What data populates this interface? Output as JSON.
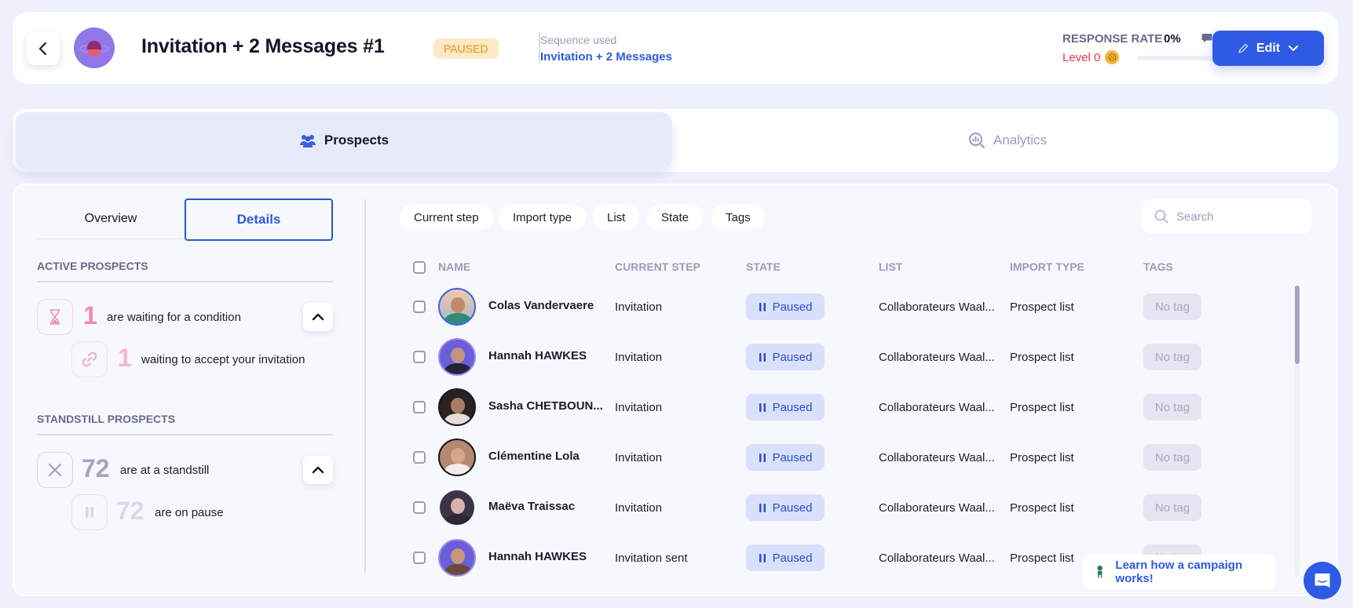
{
  "header": {
    "title": "Invitation + 2 Messages #1",
    "status": "PAUSED",
    "sequence_label": "Sequence used",
    "sequence_name": "Invitation + 2 Messages",
    "response_rate_label": "RESPONSE RATE",
    "response_rate_value": "0%",
    "level_label": "Level 0",
    "level_progress": 0,
    "edit_label": "Edit"
  },
  "tabs": [
    {
      "label": "Prospects",
      "icon": "users-icon",
      "active": true
    },
    {
      "label": "Analytics",
      "icon": "analytics-search-icon",
      "active": false
    }
  ],
  "segment": {
    "overview": "Overview",
    "details": "Details",
    "active": "Details"
  },
  "active_section": {
    "title": "ACTIVE PROSPECTS",
    "main": {
      "count": "1",
      "text": "are waiting for a condition",
      "icon": "hourglass-icon"
    },
    "sub": {
      "count": "1",
      "text": "waiting to accept your invitation",
      "icon": "link-icon"
    }
  },
  "standstill_section": {
    "title": "STANDSTILL PROSPECTS",
    "main": {
      "count": "72",
      "text": "are at a standstill",
      "icon": "x-icon"
    },
    "sub": {
      "count": "72",
      "text": "are on pause",
      "icon": "pause-icon"
    }
  },
  "filters": [
    "Current step",
    "Import type",
    "List",
    "State",
    "Tags"
  ],
  "search": {
    "placeholder": "Search",
    "value": ""
  },
  "table": {
    "columns": [
      "NAME",
      "CURRENT STEP",
      "STATE",
      "LIST",
      "IMPORT TYPE",
      "TAGS"
    ],
    "rows": [
      {
        "name": "Colas Vandervaere",
        "step": "Invitation",
        "state": "Paused",
        "list": "Collaborateurs Waal...",
        "import_type": "Prospect list",
        "tags": "No tag"
      },
      {
        "name": "Hannah HAWKES",
        "step": "Invitation",
        "state": "Paused",
        "list": "Collaborateurs Waal...",
        "import_type": "Prospect list",
        "tags": "No tag"
      },
      {
        "name": "Sasha CHETBOUN...",
        "step": "Invitation",
        "state": "Paused",
        "list": "Collaborateurs Waal...",
        "import_type": "Prospect list",
        "tags": "No tag"
      },
      {
        "name": "Clémentine Lola",
        "step": "Invitation",
        "state": "Paused",
        "list": "Collaborateurs Waal...",
        "import_type": "Prospect list",
        "tags": "No tag"
      },
      {
        "name": "Maëva Traissac",
        "step": "Invitation",
        "state": "Paused",
        "list": "Collaborateurs Waal...",
        "import_type": "Prospect list",
        "tags": "No tag"
      },
      {
        "name": "Hannah HAWKES",
        "step": "Invitation sent",
        "state": "Paused",
        "list": "Collaborateurs Waal...",
        "import_type": "Prospect list",
        "tags": "No tag"
      }
    ]
  },
  "help": {
    "learn_label": "Learn how a campaign works!"
  },
  "colors": {
    "accent": "#2f5be4",
    "paused_badge_bg": "#fde9c6",
    "paused_badge_text": "#e8910c",
    "level_text": "#e4344f"
  }
}
